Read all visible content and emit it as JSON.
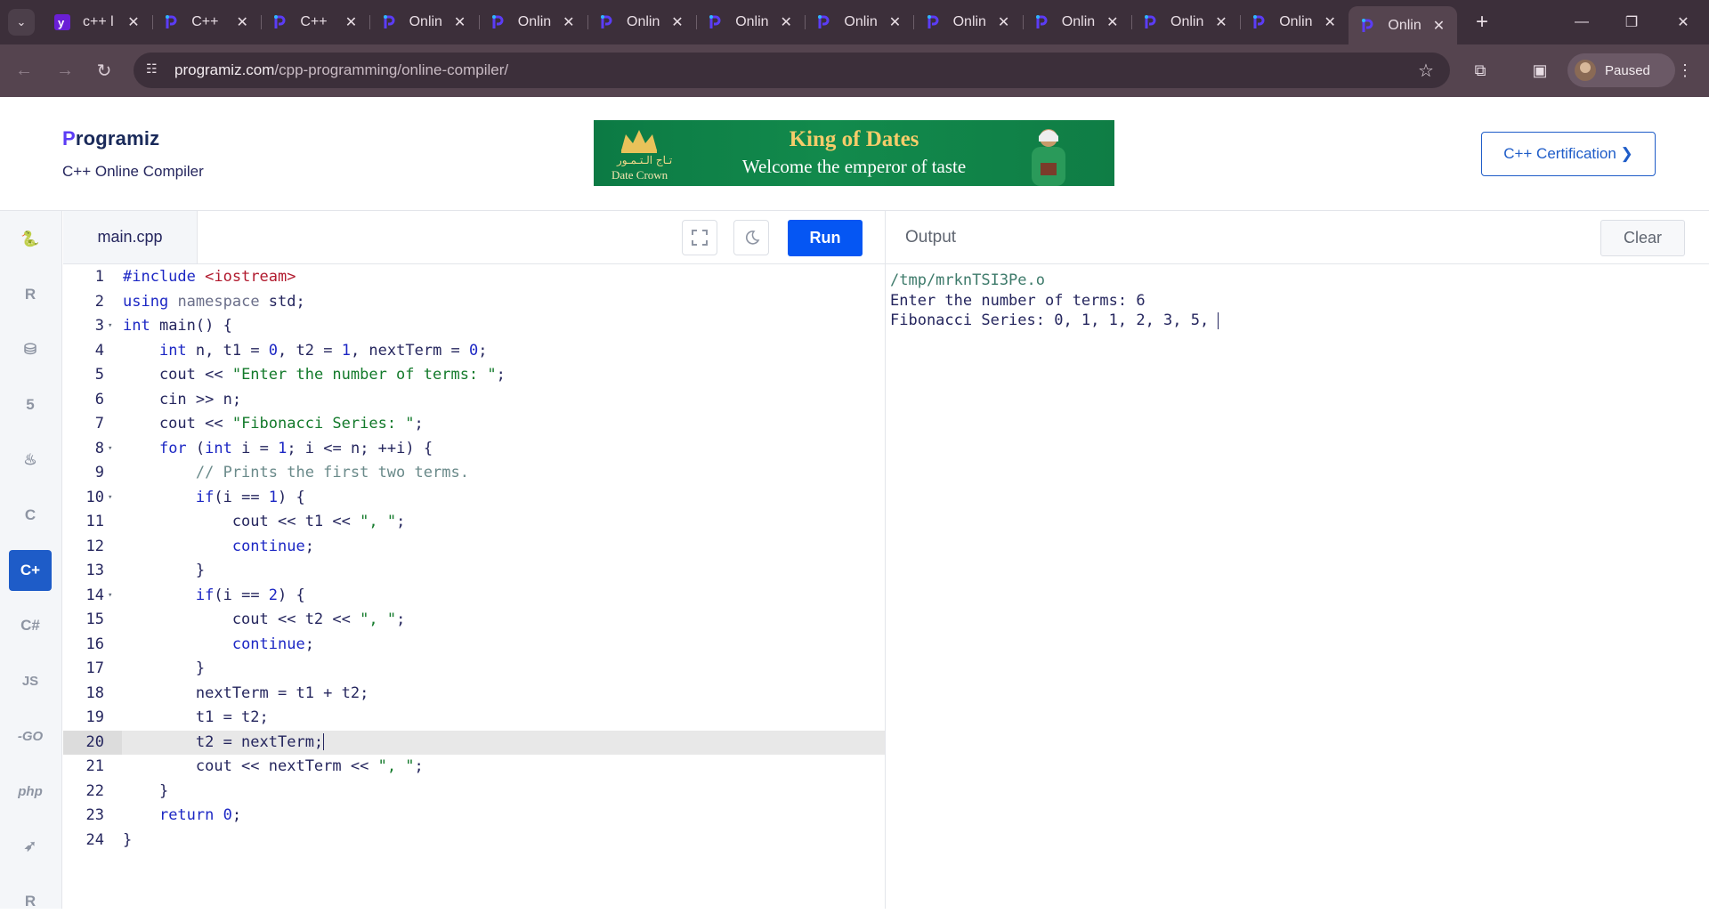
{
  "browser": {
    "tabs": [
      {
        "title": "c++ l",
        "icon": "yahoo-icon"
      },
      {
        "title": "C++",
        "icon": "programiz-icon"
      },
      {
        "title": "C++",
        "icon": "programiz-icon"
      },
      {
        "title": "Onlin",
        "icon": "programiz-icon"
      },
      {
        "title": "Onlin",
        "icon": "programiz-icon"
      },
      {
        "title": "Onlin",
        "icon": "programiz-icon"
      },
      {
        "title": "Onlin",
        "icon": "programiz-icon"
      },
      {
        "title": "Onlin",
        "icon": "programiz-icon"
      },
      {
        "title": "Onlin",
        "icon": "programiz-icon"
      },
      {
        "title": "Onlin",
        "icon": "programiz-icon"
      },
      {
        "title": "Onlin",
        "icon": "programiz-icon"
      },
      {
        "title": "Onlin",
        "icon": "programiz-icon"
      },
      {
        "title": "Onlin",
        "icon": "programiz-icon",
        "active": true
      }
    ],
    "url_host": "programiz.com",
    "url_path": "/cpp-programming/online-compiler/",
    "profile_label": "Paused"
  },
  "header": {
    "logo_first": "P",
    "logo_rest": "rogramiz",
    "subtitle": "C++ Online Compiler",
    "ad": {
      "brand_arabic": "تـاج الـتـمـور",
      "brand_name": "Date Crown",
      "headline": "King of Dates",
      "tagline": "Welcome the emperor of taste"
    },
    "cert_button": "C++ Certification ❯"
  },
  "rail": {
    "items": [
      {
        "name": "python",
        "icon": "python-icon",
        "glyph": "🐍"
      },
      {
        "name": "r",
        "icon": "r-icon",
        "glyph": "R"
      },
      {
        "name": "sql",
        "icon": "database-icon",
        "glyph": "⛁"
      },
      {
        "name": "html",
        "icon": "html5-icon",
        "glyph": "5"
      },
      {
        "name": "java",
        "icon": "java-icon",
        "glyph": "♨"
      },
      {
        "name": "c",
        "icon": "c-icon",
        "glyph": "C"
      },
      {
        "name": "cpp",
        "icon": "cpp-icon",
        "glyph": "C+",
        "active": true
      },
      {
        "name": "csharp",
        "icon": "csharp-icon",
        "glyph": "C#"
      },
      {
        "name": "js",
        "icon": "js-icon",
        "glyph": "JS"
      },
      {
        "name": "go",
        "icon": "go-icon",
        "glyph": "-GO"
      },
      {
        "name": "php",
        "icon": "php-icon",
        "glyph": "php"
      },
      {
        "name": "swift",
        "icon": "swift-icon",
        "glyph": "➶"
      },
      {
        "name": "rust",
        "icon": "rust-icon",
        "glyph": "R"
      }
    ]
  },
  "editor": {
    "file_name": "main.cpp",
    "run_label": "Run",
    "current_line": 20,
    "lines": [
      "#include <iostream>",
      "using namespace std;",
      "int main() {",
      "    int n, t1 = 0, t2 = 1, nextTerm = 0;",
      "    cout << \"Enter the number of terms: \";",
      "    cin >> n;",
      "    cout << \"Fibonacci Series: \";",
      "    for (int i = 1; i <= n; ++i) {",
      "        // Prints the first two terms.",
      "        if(i == 1) {",
      "            cout << t1 << \", \";",
      "            continue;",
      "        }",
      "        if(i == 2) {",
      "            cout << t2 << \", \";",
      "            continue;",
      "        }",
      "        nextTerm = t1 + t2;",
      "        t1 = t2;",
      "        t2 = nextTerm;",
      "        cout << nextTerm << \", \";",
      "    }",
      "    return 0;",
      "}"
    ],
    "fold_lines": [
      3,
      8,
      10,
      14
    ]
  },
  "output": {
    "title": "Output",
    "clear_label": "Clear",
    "lines": [
      "/tmp/mrknTSI3Pe.o",
      "Enter the number of terms: 6",
      "Fibonacci Series: 0, 1, 1, 2, 3, 5, "
    ]
  }
}
